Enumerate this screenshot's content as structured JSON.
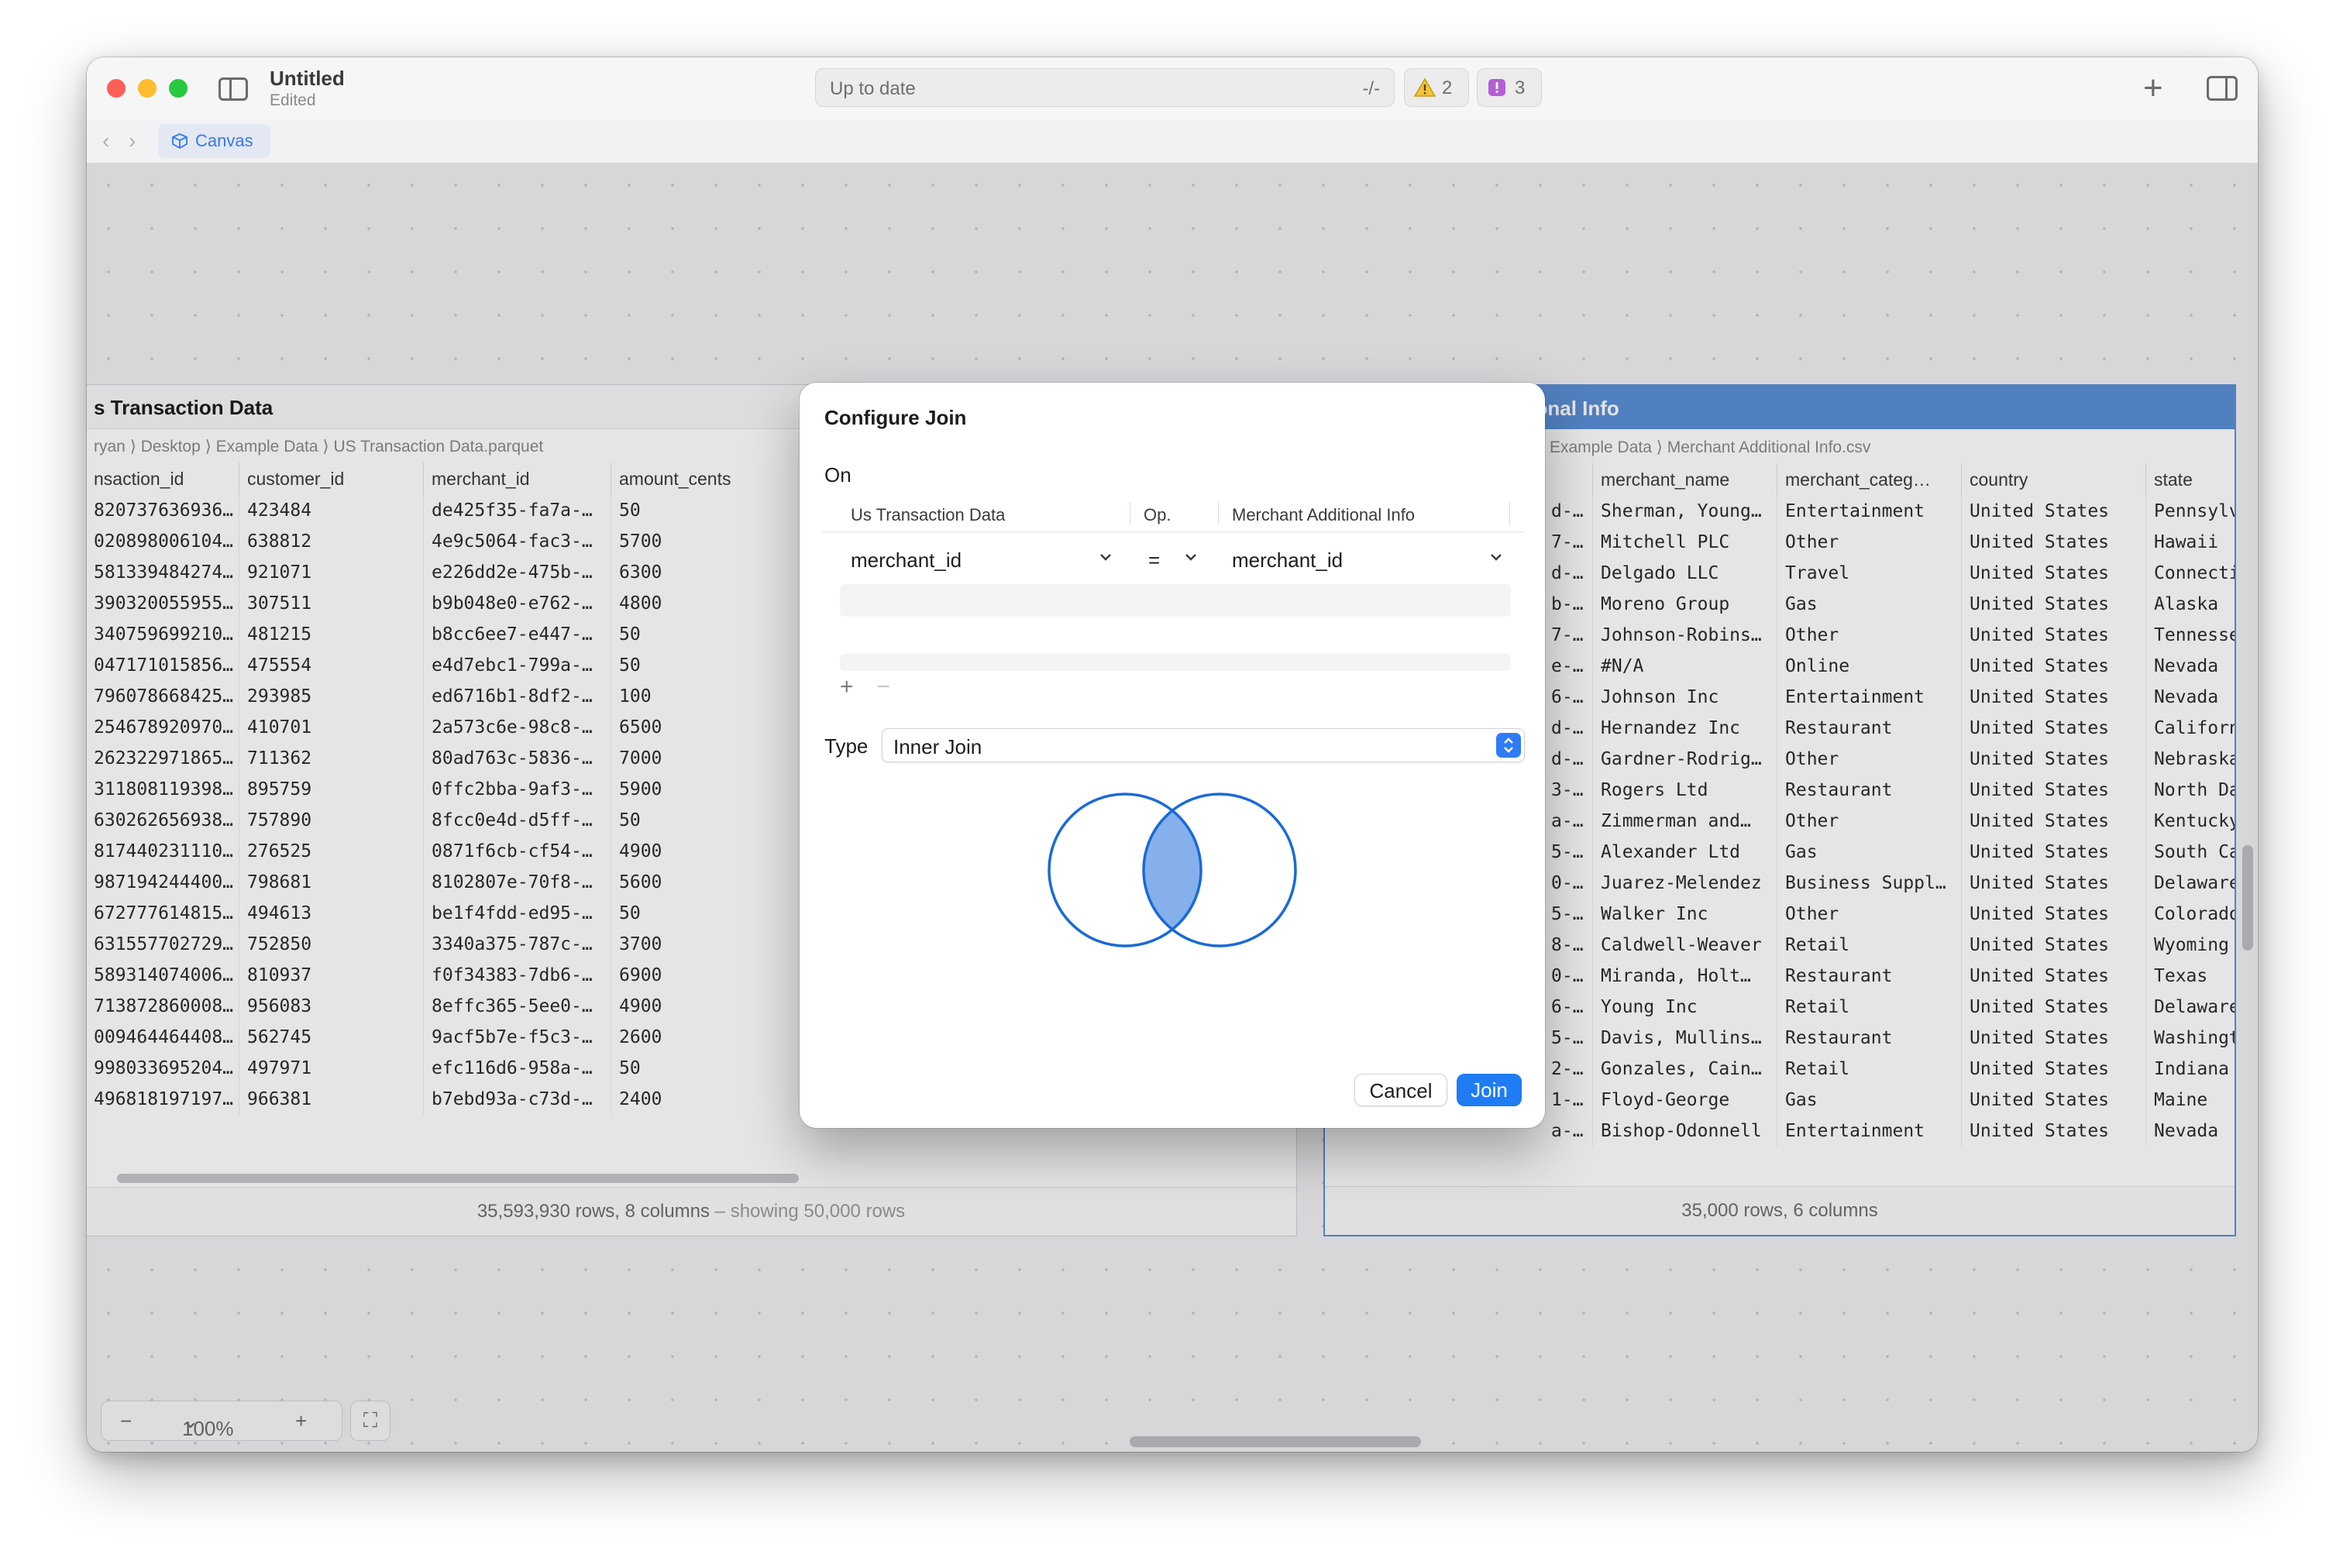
{
  "window": {
    "doc_title": "Untitled",
    "doc_subtitle": "Edited",
    "status": "Up to date",
    "status_shortcut": "-/-",
    "warnings_count": "2",
    "issues_count": "3"
  },
  "tabbar": {
    "back": "‹",
    "forward": "›",
    "canvas_tab": "Canvas"
  },
  "left_panel": {
    "title": "s Transaction Data",
    "path": [
      "ryan",
      "Desktop",
      "Example Data",
      "US Transaction Data.parquet"
    ],
    "columns": [
      "nsaction_id",
      "customer_id",
      "merchant_id",
      "amount_cents"
    ],
    "rows": [
      [
        "820737636936…",
        "423484",
        "de425f35-fa7a-…",
        "50"
      ],
      [
        "020898006104…",
        "638812",
        "4e9c5064-fac3-…",
        "5700"
      ],
      [
        "581339484274…",
        "921071",
        "e226dd2e-475b-…",
        "6300"
      ],
      [
        "390320055955…",
        "307511",
        "b9b048e0-e762-…",
        "4800"
      ],
      [
        "340759699210…",
        "481215",
        "b8cc6ee7-e447-…",
        "50"
      ],
      [
        "047171015856…",
        "475554",
        "e4d7ebc1-799a-…",
        "50"
      ],
      [
        "796078668425…",
        "293985",
        "ed6716b1-8df2-…",
        "100"
      ],
      [
        "254678920970…",
        "410701",
        "2a573c6e-98c8-…",
        "6500"
      ],
      [
        "262322971865…",
        "711362",
        "80ad763c-5836-…",
        "7000"
      ],
      [
        "311808119398…",
        "895759",
        "0ffc2bba-9af3-…",
        "5900"
      ],
      [
        "630262656938…",
        "757890",
        "8fcc0e4d-d5ff-…",
        "50"
      ],
      [
        "817440231110…",
        "276525",
        "0871f6cb-cf54-…",
        "4900"
      ],
      [
        "987194244400…",
        "798681",
        "8102807e-70f8-…",
        "5600"
      ],
      [
        "672777614815…",
        "494613",
        "be1f4fdd-ed95-…",
        "50"
      ],
      [
        "631557702729…",
        "752850",
        "3340a375-787c-…",
        "3700"
      ],
      [
        "589314074006…",
        "810937",
        "f0f34383-7db6-…",
        "6900"
      ],
      [
        "713872860008…",
        "956083",
        "8effc365-5ee0-…",
        "4900"
      ],
      [
        "009464464408…",
        "562745",
        "9acf5b7e-f5c3-…",
        "2600"
      ],
      [
        "998033695204…",
        "497971",
        "efc116d6-958a-…",
        "50"
      ],
      [
        "496818197197…",
        "966381",
        "b7ebd93a-c73d-…",
        "2400"
      ]
    ],
    "footer_main": "35,593,930 rows, 8 columns",
    "footer_suffix": " – showing 50,000 rows"
  },
  "right_panel": {
    "title": "Merchant Additional Info",
    "path": [
      "Example Data",
      "Merchant Additional Info.csv"
    ],
    "columns": [
      "merchant_name",
      "merchant_categ…",
      "country",
      "state"
    ],
    "rows": [
      [
        "d-…",
        "Sherman, Young…",
        "Entertainment",
        "United States",
        "Pennsylva"
      ],
      [
        "7-…",
        "Mitchell PLC",
        "Other",
        "United States",
        "Hawaii"
      ],
      [
        "d-…",
        "Delgado LLC",
        "Travel",
        "United States",
        "Connecti"
      ],
      [
        "b-…",
        "Moreno Group",
        "Gas",
        "United States",
        "Alaska"
      ],
      [
        "7-…",
        "Johnson-Robins…",
        "Other",
        "United States",
        "Tennesse"
      ],
      [
        "e-…",
        "#N/A",
        "Online",
        "United States",
        "Nevada"
      ],
      [
        "6-…",
        "Johnson Inc",
        "Entertainment",
        "United States",
        "Nevada"
      ],
      [
        "d-…",
        "Hernandez Inc",
        "Restaurant",
        "United States",
        "Californ"
      ],
      [
        "d-…",
        "Gardner-Rodrig…",
        "Other",
        "United States",
        "Nebraska"
      ],
      [
        "3-…",
        "Rogers Ltd",
        "Restaurant",
        "United States",
        "North Da"
      ],
      [
        "a-…",
        "Zimmerman and…",
        "Other",
        "United States",
        "Kentucky"
      ],
      [
        "5-…",
        "Alexander Ltd",
        "Gas",
        "United States",
        "South Ca"
      ],
      [
        "0-…",
        "Juarez-Melendez",
        "Business Suppl…",
        "United States",
        "Delaware"
      ],
      [
        "5-…",
        "Walker Inc",
        "Other",
        "United States",
        "Colorado"
      ],
      [
        "8-…",
        "Caldwell-Weaver",
        "Retail",
        "United States",
        "Wyoming"
      ],
      [
        "0-…",
        "Miranda, Holt…",
        "Restaurant",
        "United States",
        "Texas"
      ],
      [
        "6-…",
        "Young Inc",
        "Retail",
        "United States",
        "Delaware"
      ],
      [
        "5-…",
        "Davis, Mullins…",
        "Restaurant",
        "United States",
        "Washingto"
      ],
      [
        "2-…",
        "Gonzales, Cain…",
        "Retail",
        "United States",
        "Indiana"
      ],
      [
        "1-…",
        "Floyd-George",
        "Gas",
        "United States",
        "Maine"
      ],
      [
        "a-…",
        "Bishop-Odonnell",
        "Entertainment",
        "United States",
        "Nevada"
      ]
    ],
    "footer": "35,000 rows, 6 columns"
  },
  "zoom": {
    "minus": "−",
    "level": "100%",
    "plus": "+"
  },
  "dialog": {
    "title": "Configure Join",
    "on_label": "On",
    "col_left": "Us Transaction Data",
    "col_op": "Op.",
    "col_right": "Merchant Additional Info",
    "left_value": "merchant_id",
    "op_value": "=",
    "right_value": "merchant_id",
    "add": "+",
    "remove": "−",
    "type_label": "Type",
    "type_value": "Inner Join",
    "cancel": "Cancel",
    "join": "Join"
  },
  "colors": {
    "accent": "#1f7cf3",
    "selected_header": "#5b8fd6",
    "venn_stroke": "#1a6ad6",
    "venn_fill": "#86b0ec"
  }
}
